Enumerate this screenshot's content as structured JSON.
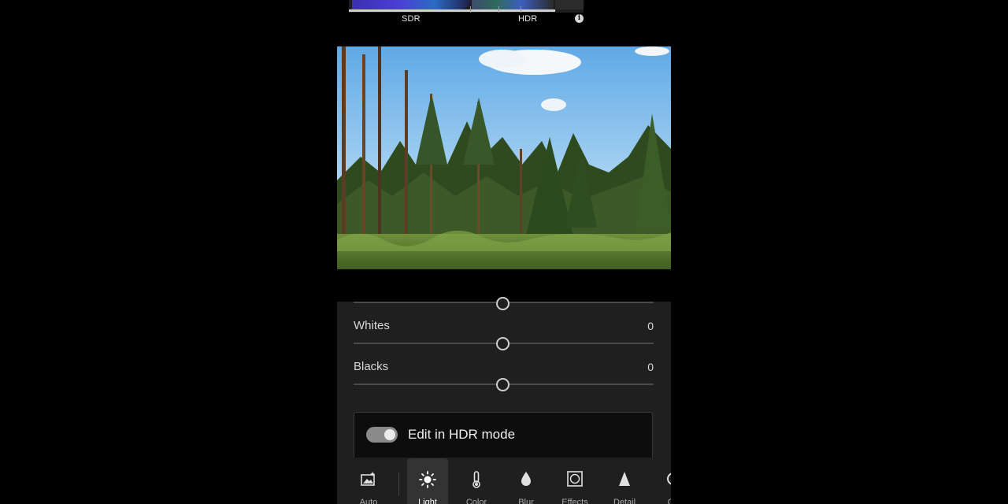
{
  "histogram": {
    "sdr_label": "SDR",
    "hdr_label": "HDR"
  },
  "sliders": [
    {
      "label": "Whites",
      "value": "0"
    },
    {
      "label": "Blacks",
      "value": "0"
    }
  ],
  "hdr_mode": {
    "label": "Edit in HDR mode",
    "enabled": true
  },
  "toolbar": {
    "items": [
      {
        "label": "Auto",
        "icon": "auto-photo-icon"
      },
      {
        "label": "Light",
        "icon": "sun-icon",
        "active": true
      },
      {
        "label": "Color",
        "icon": "thermometer-icon"
      },
      {
        "label": "Blur",
        "icon": "drop-icon"
      },
      {
        "label": "Effects",
        "icon": "effects-icon"
      },
      {
        "label": "Detail",
        "icon": "triangle-icon"
      },
      {
        "label": "Op",
        "icon": "optics-icon"
      }
    ]
  },
  "colors": {
    "background": "#000000",
    "panel": "#1f1f1f",
    "toggle_on": "#8a8a8a"
  }
}
